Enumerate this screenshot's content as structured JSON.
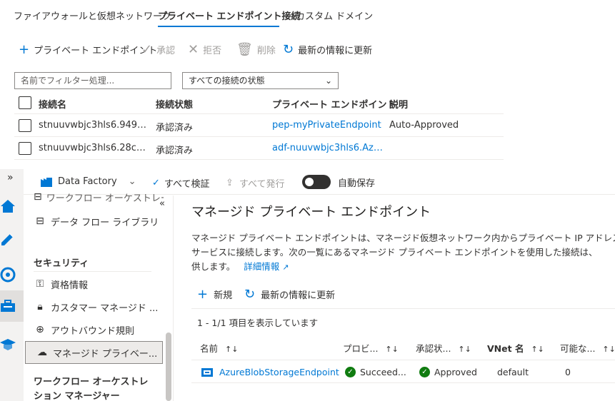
{
  "tabs": [
    {
      "label": "ファイアウォールと仮想ネットワーク",
      "active": false
    },
    {
      "label": "プライベート エンドポイント接続",
      "active": true
    },
    {
      "label": "カスタム ドメイン",
      "active": false
    }
  ],
  "toolbar": {
    "add_label": "プライベート エンドポイント",
    "approve_label": "承認",
    "reject_label": "拒否",
    "delete_label": "削除",
    "refresh_label": "最新の情報に更新"
  },
  "filter": {
    "placeholder": "名前でフィルター処理...",
    "status_selected": "すべての接続の状態"
  },
  "connections": {
    "headers": [
      "接続名",
      "接続状態",
      "プライベート エンドポイント",
      "説明"
    ],
    "rows": [
      {
        "name": "stnuuvwbjc3hls6.949…",
        "state": "承認済み",
        "endpoint": "pep-myPrivateEndpoint",
        "description": "Auto-Approved"
      },
      {
        "name": "stnuuvwbjc3hls6.28c…",
        "state": "承認済み",
        "endpoint": "adf-nuuvwbjc3hls6.Az…",
        "description": ""
      }
    ]
  },
  "adf_toolbar": {
    "factory_label": "Data Factory",
    "validate_all_label": "すべて検証",
    "publish_all_label": "すべて発行",
    "autosave_label": "自動保存"
  },
  "sidenav": {
    "partial_item": "ワークフロー オーケストレーション",
    "dataflow_library": "データ フロー ライブラリ",
    "security_section": "セキュリティ",
    "credentials": "資格情報",
    "cmk": "カスタマー マネージド ...",
    "outbound_rules": "アウトバウンド規則",
    "managed_private": "マネージド プライベー...",
    "workflow_section_line1": "ワークフロー オーケストレ",
    "workflow_section_line2": "ション マネージャー"
  },
  "main": {
    "title": "マネージド プライベート エンドポイント",
    "desc_line1": "マネージド プライベート エンドポイントは、マネージド仮想ネットワーク内からプライベート IP アドレスを使用して",
    "desc_line2": "サービスに接続します。次の一覧にあるマネージド プライベート エンドポイントを使用した接続は、",
    "desc_line3": "供します。",
    "learn_more": "詳細情報",
    "new_label": "新規",
    "refresh_label": "最新の情報に更新",
    "count_text": "1 - 1/1 項目を表示しています",
    "columns": [
      "名前",
      "プロビ...",
      "承認状...",
      "VNet 名",
      "可能な..."
    ],
    "rows": [
      {
        "name": "AzureBlobStorageEndpoint",
        "provisioning": "Succeed...",
        "approval": "Approved",
        "vnet": "default",
        "possible": "0"
      }
    ]
  },
  "colors": {
    "accent": "#0078d4",
    "success": "#107c10"
  }
}
